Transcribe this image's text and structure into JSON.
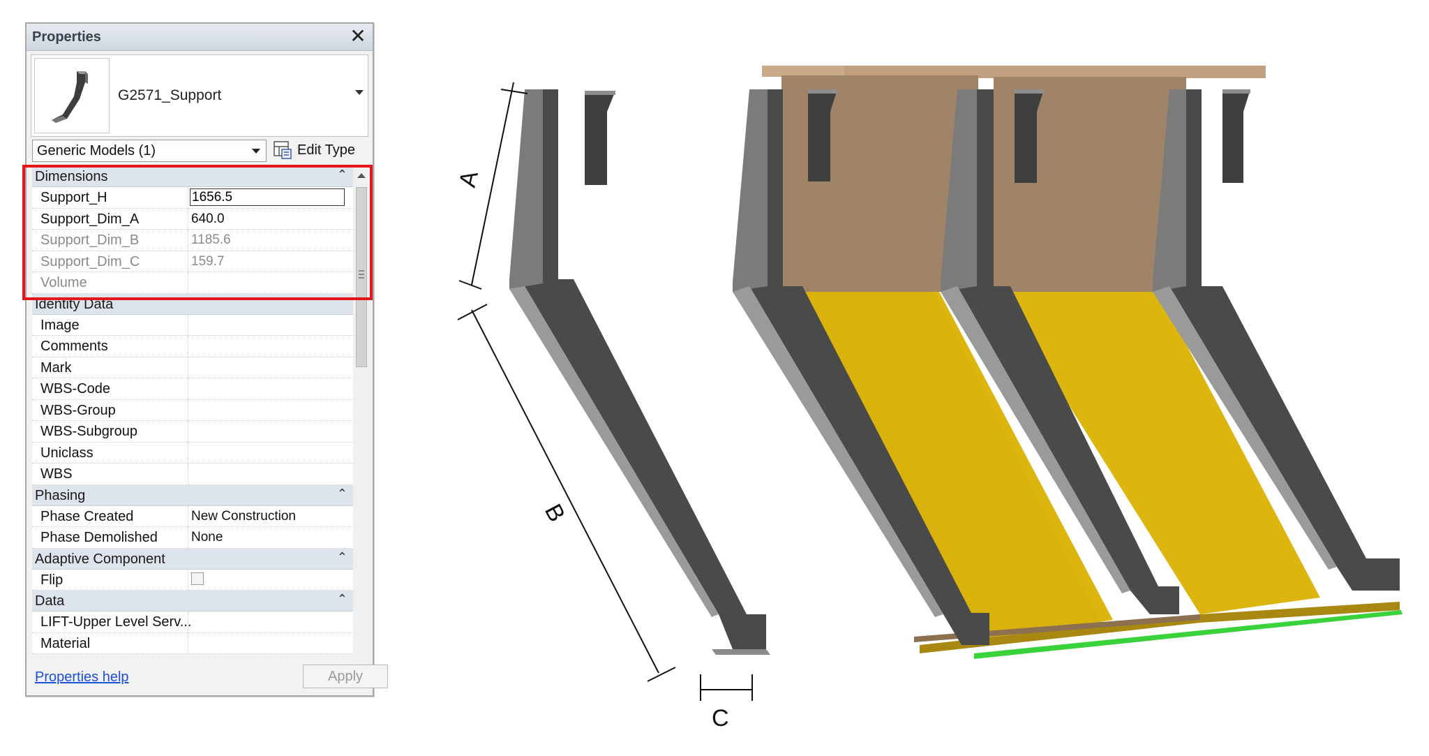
{
  "palette": {
    "title": "Properties",
    "type_name": "G2571_Support",
    "filter": "Generic Models (1)",
    "edit_type_label": "Edit Type",
    "help_link": "Properties help",
    "apply_label": "Apply",
    "groups": [
      {
        "title": "Dimensions",
        "rows": [
          {
            "name": "Support_H",
            "value": "1656.5",
            "editing": true,
            "greyed": false
          },
          {
            "name": "Support_Dim_A",
            "value": "640.0",
            "greyed": false
          },
          {
            "name": "Support_Dim_B",
            "value": "1185.6",
            "greyed": true
          },
          {
            "name": "Support_Dim_C",
            "value": "159.7",
            "greyed": true
          },
          {
            "name": "Volume",
            "value": "",
            "greyed": true
          }
        ]
      },
      {
        "title": "Identity Data",
        "rows": [
          {
            "name": "Image",
            "value": ""
          },
          {
            "name": "Comments",
            "value": ""
          },
          {
            "name": "Mark",
            "value": ""
          },
          {
            "name": "WBS-Code",
            "value": ""
          },
          {
            "name": "WBS-Group",
            "value": ""
          },
          {
            "name": "WBS-Subgroup",
            "value": ""
          },
          {
            "name": "Uniclass",
            "value": ""
          },
          {
            "name": "WBS",
            "value": ""
          }
        ]
      },
      {
        "title": "Phasing",
        "rows": [
          {
            "name": "Phase Created",
            "value": "New Construction"
          },
          {
            "name": "Phase Demolished",
            "value": "None"
          }
        ]
      },
      {
        "title": "Adaptive Component",
        "rows": [
          {
            "name": "Flip",
            "value": "",
            "checkbox": true
          }
        ]
      },
      {
        "title": "Data",
        "rows": [
          {
            "name": "LIFT-Upper Level Serv...",
            "value": ""
          },
          {
            "name": "Material",
            "value": ""
          }
        ]
      }
    ]
  },
  "drawing": {
    "dim_labels": {
      "a": "A",
      "b": "B",
      "c": "C"
    },
    "colors": {
      "steel": "#4a4a4a",
      "steel_edge": "#8e8e8e",
      "backboard": "#a08467",
      "tray": "#dcb60e",
      "tray_edge": "#a88810",
      "base_strip": "#39d23a",
      "highlight": "#e3161d"
    }
  }
}
